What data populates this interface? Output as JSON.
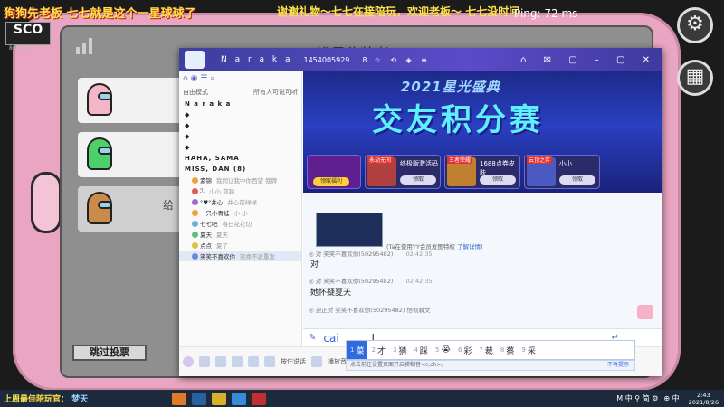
{
  "stream": {
    "overlay_left": "狗狗先老板 七七就是这个一星球球了",
    "overlay_right_a": "谢谢礼物～七七在接陪玩，欢迎老板～",
    "overlay_right_b": "七七没时间",
    "ping": "Ping: 72 ms",
    "logo": "SCO",
    "logo_sub": "8602_1.0"
  },
  "game": {
    "meeting_title": "谁是伪装者?",
    "vote_label": "给",
    "skip_vote_label": "跳过投票",
    "settings_icon": "gear-icon",
    "map_icon": "map-icon"
  },
  "app": {
    "title_name": "N a r a k a",
    "title_id": "1454005929",
    "title_count": "8",
    "tool_icons": "☆ ⟲ ◈ ≡",
    "window_controls": "⌂ ✉ ▢ – ▢ ✕",
    "sidebar": {
      "icons": "⌂ ◉ ☰ ⌕",
      "mode_left": "自由模式",
      "mode_right": "所有人可说可听",
      "channels": [
        {
          "label": "N a r a k a",
          "bold": true
        },
        {
          "label": "◆",
          "bold": false
        },
        {
          "label": "◆",
          "bold": false
        },
        {
          "label": "◆",
          "bold": false
        },
        {
          "label": "◆",
          "bold": false
        },
        {
          "label": "HAHA, SAMA",
          "bold": true
        },
        {
          "label": "MISS, DAN (8)",
          "bold": true
        }
      ],
      "users": [
        {
          "name": "素锦",
          "tag": "我同让我中你西望 我牌"
        },
        {
          "name": "ℐ.",
          "tag": "小小 前踏"
        },
        {
          "name": "°♥°井心",
          "tag": "井心前绿绿"
        },
        {
          "name": "一只小青蛙",
          "tag": "小 小"
        },
        {
          "name": "七七吧",
          "tag": "春日花花切"
        },
        {
          "name": "夏天",
          "tag": "夏天"
        },
        {
          "name": "点点",
          "tag": "夏了"
        },
        {
          "name": "笑笑不喜欢你",
          "tag": "笑命不说重发"
        }
      ]
    },
    "banner": {
      "year": "2021星光盛典",
      "title": "交友积分赛",
      "cards": [
        {
          "tag": "",
          "label": "",
          "button": "领取福利"
        },
        {
          "tag": "永劫无间",
          "label": "终极版激活码",
          "button": "领取"
        },
        {
          "tag": "王者荣耀",
          "label": "1688点券皮肤",
          "button": "领取"
        },
        {
          "tag": "云顶之弈",
          "label": "小小",
          "button": "领取"
        }
      ]
    },
    "chat": {
      "system_text": "(Ta在使用YY会员发图特权",
      "system_link": "了解详情)",
      "messages": [
        {
          "meta": "◎ 对 笑笑不喜欢你(50295482)",
          "time": "02:42:35",
          "text": "对"
        },
        {
          "meta": "◎ 对 笑笑不喜欢你(50295482)",
          "time": "02:42:35",
          "text": "她怀疑夏天"
        },
        {
          "meta": "◎ 迎正对 笑笑不喜欢你(50295482) 悟彻棘文",
          "time": "",
          "text": ""
        }
      ]
    },
    "input": {
      "value": "cai",
      "cursor": "I",
      "send_icon": "↵"
    },
    "toolbar": {
      "mic_label": "按住说话",
      "music_label": "播放音乐"
    }
  },
  "ime": {
    "candidates": [
      {
        "num": "1",
        "text": "菜",
        "selected": true
      },
      {
        "num": "2",
        "text": "才",
        "selected": false
      },
      {
        "num": "3",
        "text": "猜",
        "selected": false
      },
      {
        "num": "4",
        "text": "踩",
        "selected": false
      },
      {
        "num": "5",
        "text": "😭",
        "selected": false
      },
      {
        "num": "6",
        "text": "彩",
        "selected": false
      },
      {
        "num": "7",
        "text": "裁",
        "selected": false
      },
      {
        "num": "8",
        "text": "蔡",
        "selected": false
      },
      {
        "num": "9",
        "text": "采",
        "selected": false
      }
    ],
    "tip": "点击前往设置页面开启模糊音<c,ch>。",
    "tip_link": "不再提示"
  },
  "taskbar": {
    "marquee": "上周最佳陪玩官：",
    "marquee_name": "梦天",
    "tray": "M 中 ⚲ 简 ⚙",
    "tray2": "⊕ 中",
    "time": "2:43",
    "date": "2021/8/26"
  },
  "colors": {
    "tablet": "#e9a5c1",
    "title_gradient": "#5a4bc8",
    "accent": "#2f6be0"
  }
}
